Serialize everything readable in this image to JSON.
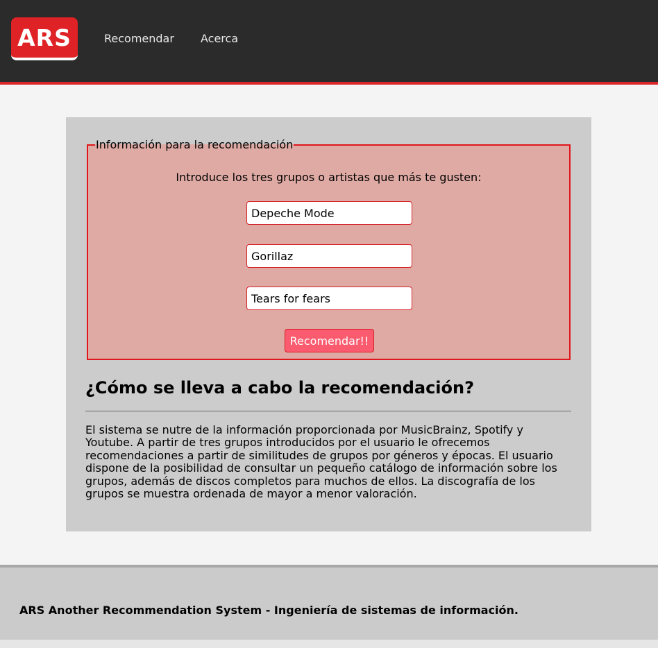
{
  "header": {
    "logo_text": "ARS",
    "nav": [
      "Recomendar",
      "Acerca"
    ],
    "accent_color": "#df2226"
  },
  "form": {
    "legend": "Información para la recomendación",
    "intro": "Introduce los tres grupos o artistas que más te gusten:",
    "inputs": [
      "Depeche Mode",
      "Gorillaz",
      "Tears for fears"
    ],
    "button_label": "Recomendar!!"
  },
  "section": {
    "title": "¿Cómo se lleva a cabo la recomendación?",
    "body": "El sistema se nutre de la información proporcionada por MusicBrainz, Spotify y Youtube. A partir de tres grupos introducidos por el usuario le ofrecemos recomendaciones a partir de similitudes de grupos por géneros y épocas. El usuario dispone de la posibilidad de consultar un pequeño catálogo de información sobre los grupos, además de discos completos para muchos de ellos. La discografía de los grupos se muestra ordenada de mayor a menor valoración."
  },
  "footer": {
    "text": "ARS Another Recommendation System - Ingeniería de sistemas de información."
  }
}
